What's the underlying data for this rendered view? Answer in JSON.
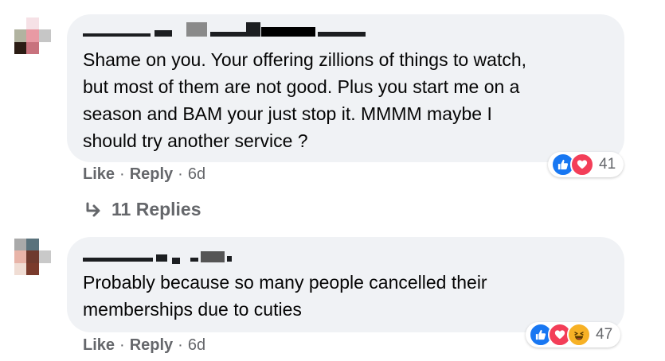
{
  "comments": [
    {
      "text_lines": [
        "Shame on you. Your offering zillions of things to watch,",
        "but most of them are not good. Plus you start me on a",
        "season and BAM your just stop it. MMMM maybe I",
        "should try another service ?"
      ],
      "actions": {
        "like": "Like",
        "reply": "Reply",
        "time": "6d"
      },
      "reactions": {
        "icons": [
          "like-icon",
          "love-icon"
        ],
        "count": "41"
      },
      "replies_label": "11 Replies"
    },
    {
      "text_lines": [
        "Probably because so many people cancelled their",
        "memberships due to cuties"
      ],
      "actions": {
        "like": "Like",
        "reply": "Reply",
        "time": "6d"
      },
      "reactions": {
        "icons": [
          "like-icon",
          "love-icon",
          "haha-icon"
        ],
        "count": "47"
      }
    }
  ],
  "separator": "·",
  "colors": {
    "bubble": "#f0f2f5",
    "like": "#1877f2",
    "love": "#f33e58",
    "haha": "#f7b125",
    "meta_text": "#65676b"
  }
}
